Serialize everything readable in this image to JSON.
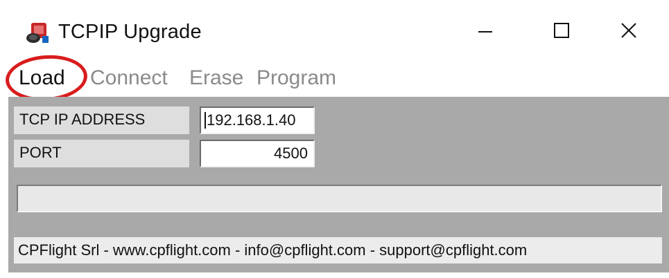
{
  "window": {
    "title": "TCPIP Upgrade",
    "icon": "tcpip-app-icon",
    "controls": {
      "minimize": "minimize-icon",
      "maximize": "maximize-icon",
      "close": "close-icon"
    }
  },
  "menu": {
    "items": [
      {
        "label": "Load",
        "active": true
      },
      {
        "label": "Connect",
        "active": false
      },
      {
        "label": "Erase",
        "active": false
      },
      {
        "label": "Program",
        "active": false
      }
    ],
    "highlight_color": "#d81c1c"
  },
  "form": {
    "ip_label": "TCP IP ADDRESS",
    "ip_value": "192.168.1.40",
    "port_label": "PORT",
    "port_value": "4500"
  },
  "progress": {
    "value": 0
  },
  "status_text": "CPFlight Srl -  www.cpflight.com - info@cpflight.com - support@cpflight.com",
  "colors": {
    "client_background": "#a9a9a9",
    "disabled_text": "#8a8a8a"
  }
}
